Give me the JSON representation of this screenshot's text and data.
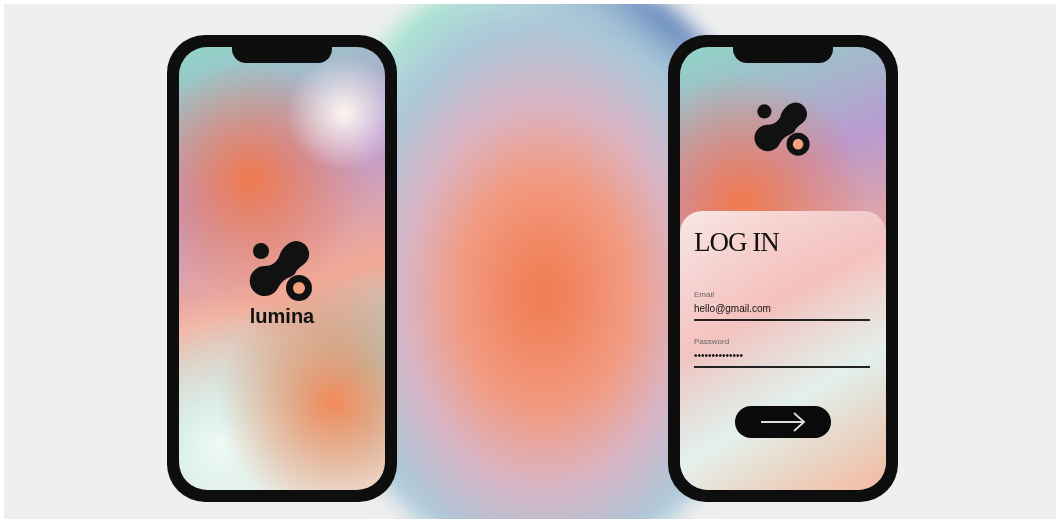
{
  "phones": [
    {
      "kind": "splash",
      "brand": "lumina"
    },
    {
      "kind": "login",
      "title": "LOG IN",
      "fields": [
        {
          "label": "Email",
          "value": "hello@gmail.com"
        },
        {
          "label": "Password",
          "value": "••••••••••••••"
        }
      ]
    }
  ]
}
